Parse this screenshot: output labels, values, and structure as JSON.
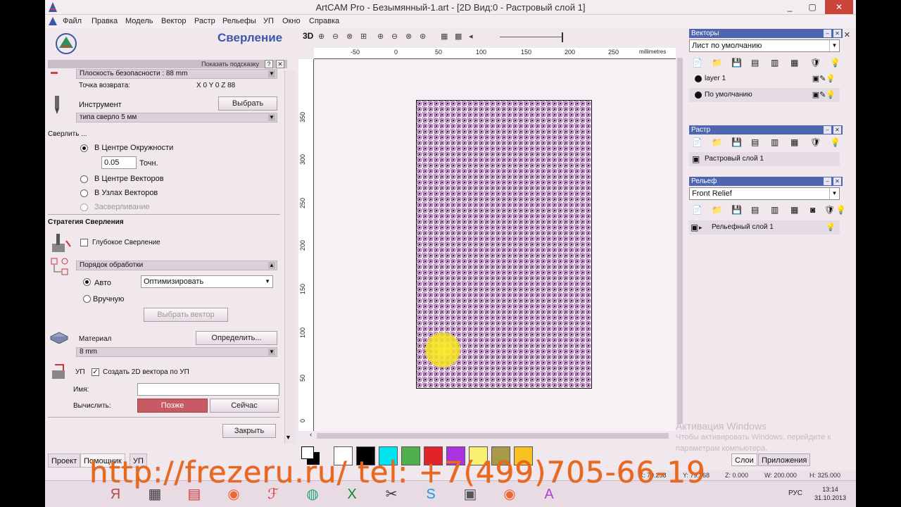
{
  "window": {
    "title": "ArtCAM Pro - Безымянный-1.art - [2D Вид:0 - Растровый слой 1]",
    "controls": [
      "_",
      "▢",
      "✕"
    ],
    "mdi_controls": "_ ▫ ✕"
  },
  "menu": [
    "Файл",
    "Правка",
    "Модель",
    "Вектор",
    "Растр",
    "Рельефы",
    "УП",
    "Окно",
    "Справка"
  ],
  "drilling": {
    "title": "Сверление",
    "show_hint": "Показать подсказку",
    "hint_q": "?",
    "hint_x": "✕",
    "safe_plane": "Плоскость безопасности : 88 mm",
    "home_point_label": "Точка возврата:",
    "home_point_value": "X 0 Y 0 Z 88",
    "tool_label": "Инструмент",
    "select_button": "Выбрать",
    "tool_value": "типа сверло 5 мм",
    "drill_section": "Сверлить ...",
    "option_circle_center": "В Центре Окружности",
    "tolerance_value": "0.05",
    "tolerance_unit": "Точн.",
    "option_vector_center": "В Центре Векторов",
    "option_vector_nodes": "В Узлах Векторов",
    "option_countersink": "Засверливание",
    "strategy_section": "Стратегия Сверления",
    "deep_drilling": "Глубокое Сверление",
    "order_bar": "Порядок обработки",
    "order_auto": "Авто",
    "order_auto_value": "Оптимизировать",
    "order_manual": "Вручную",
    "select_vector_button": "Выбрать вектор",
    "material_label": "Материал",
    "define_button": "Определить...",
    "material_value": "8 mm",
    "toolpath_label": "УП",
    "create_2d_vectors": "Создать 2D вектора по УП",
    "name_label": "Имя:",
    "name_value": "",
    "calculate_label": "Вычислить:",
    "later_button": "Позже",
    "now_button": "Сейчас",
    "close_button": "Закрыть"
  },
  "left_tabs": [
    "Проект",
    "Помощник",
    "УП"
  ],
  "view_toolbar": {
    "label_3d": "3D"
  },
  "rulers": {
    "top": [
      "-50",
      "0",
      "50",
      "100",
      "150",
      "200",
      "250",
      "millimetres"
    ],
    "left": [
      "350",
      "300",
      "250",
      "200",
      "150",
      "100",
      "50",
      "0"
    ]
  },
  "palette": {
    "colors": [
      "#ffffff",
      "#000000",
      "#00e5f0",
      "#50b050",
      "#e0242a",
      "#a835e0",
      "#f8f070",
      "#a89a48",
      "#f8c020"
    ]
  },
  "vectors_panel": {
    "title": "Векторы",
    "sheet_value": "Лист по умолчанию",
    "layers": [
      "layer 1",
      "По умолчанию"
    ]
  },
  "bitmap_panel": {
    "title": "Растр",
    "layers": [
      "Растровый слой 1"
    ]
  },
  "relief_panel": {
    "title": "Рельеф",
    "combo_value": "Front Relief",
    "layers": [
      "Рельефный слой 1"
    ]
  },
  "right_tabs": [
    "Слои",
    "Приложения"
  ],
  "activation": {
    "line1": "Активация Windows",
    "line2": "Чтобы активировать Windows, перейдите к",
    "line3": "параметрам компьютера."
  },
  "statusbar": {
    "x": "X: 79.258",
    "y": "Y: 79.268",
    "z": "Z: 0.000",
    "w": "W: 200.000",
    "h": "H: 325.000"
  },
  "taskbar": {
    "lang": "РУС",
    "time": "13:14",
    "date": "31.10.2013"
  },
  "banner": "http://frezeru.ru/   tel: +7(499)705-66-19"
}
